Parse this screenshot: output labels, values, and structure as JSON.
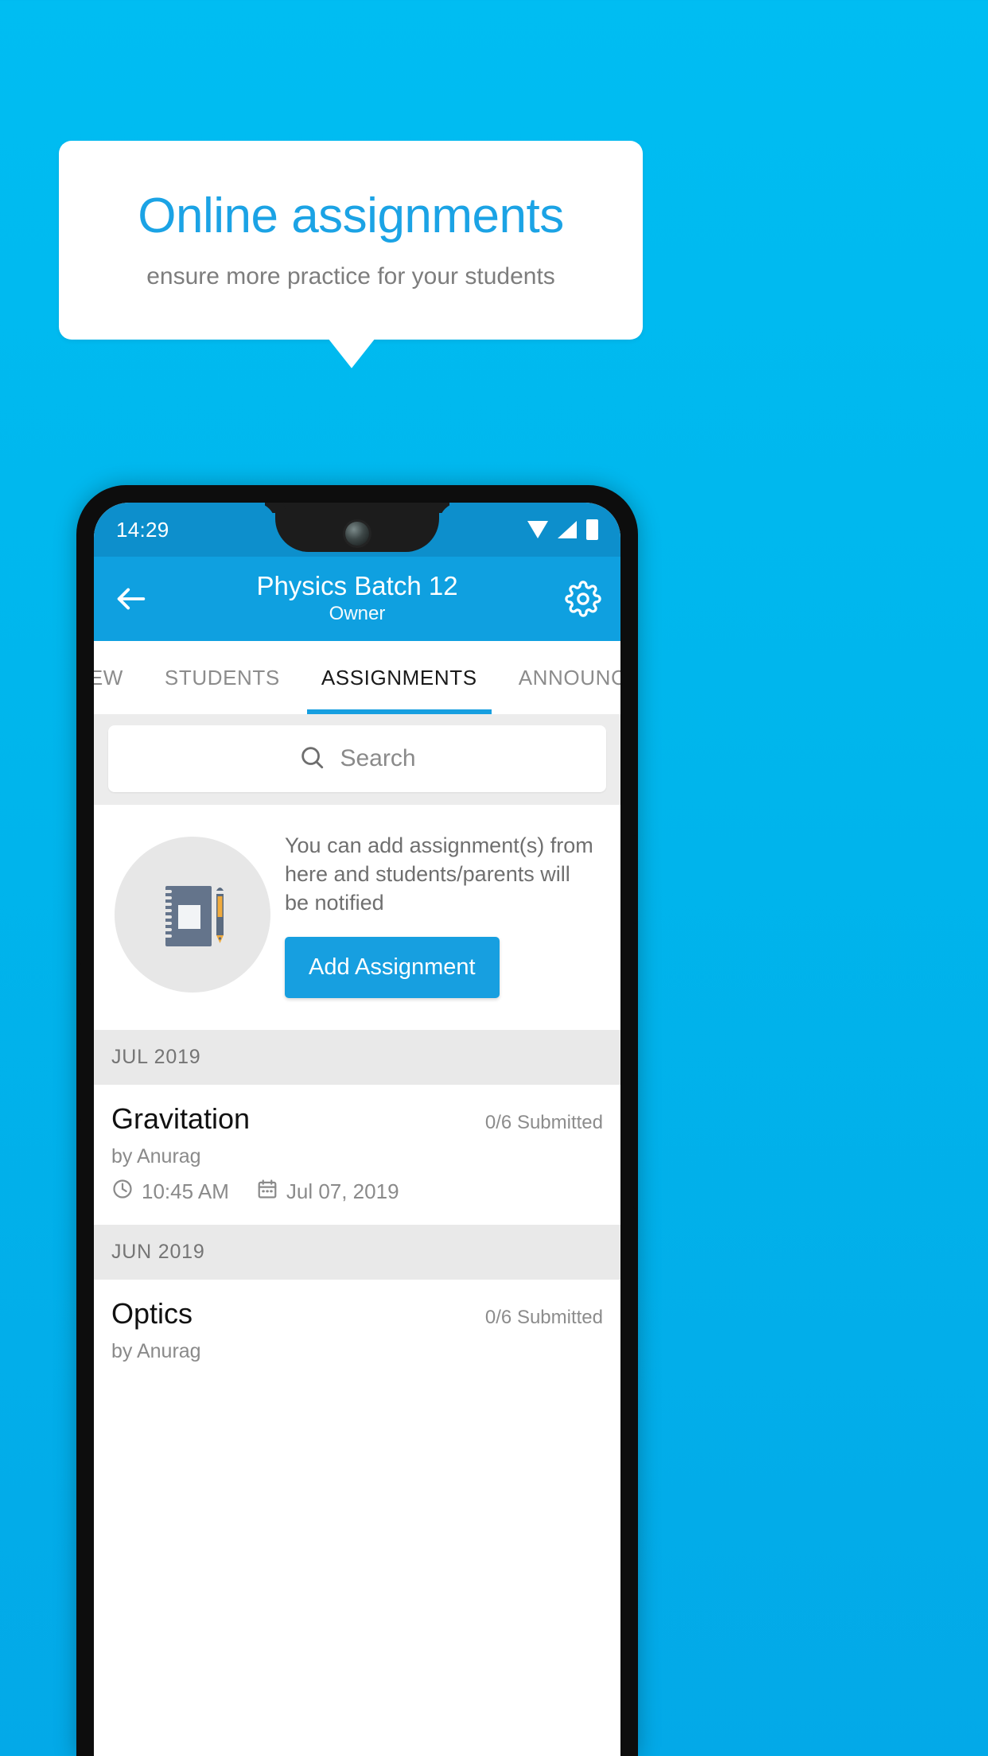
{
  "promo": {
    "title": "Online assignments",
    "subtitle": "ensure more practice for your students",
    "accent_color": "#1ba3e5",
    "background_color": "#00b5ec"
  },
  "phone": {
    "status_bar": {
      "time": "14:29",
      "icons": [
        "wifi-icon",
        "signal-icon",
        "battery-icon"
      ]
    },
    "app_bar": {
      "back_icon": "back-arrow-icon",
      "title": "Physics Batch 12",
      "subtitle": "Owner",
      "settings_icon": "gear-icon",
      "color": "#0fa0e0"
    },
    "tabs": [
      {
        "label": "IEW",
        "active": false
      },
      {
        "label": "STUDENTS",
        "active": false
      },
      {
        "label": "ASSIGNMENTS",
        "active": true
      },
      {
        "label": "ANNOUNCEM",
        "active": false
      }
    ],
    "search": {
      "placeholder": "Search",
      "icon": "search-icon"
    },
    "empty_state": {
      "illustration": "notebook-and-pen-icon",
      "message": "You can add assignment(s) from here and students/parents will be notified",
      "button_label": "Add Assignment",
      "button_color": "#179fe0"
    },
    "assignment_groups": [
      {
        "month": "JUL 2019",
        "items": [
          {
            "title": "Gravitation",
            "submitted": "0/6 Submitted",
            "author": "by Anurag",
            "time": "10:45 AM",
            "date": "Jul 07, 2019",
            "time_icon": "clock-icon",
            "date_icon": "calendar-icon"
          }
        ]
      },
      {
        "month": "JUN 2019",
        "items": [
          {
            "title": "Optics",
            "submitted": "0/6 Submitted",
            "author": "by Anurag",
            "time": "",
            "date": "",
            "time_icon": "clock-icon",
            "date_icon": "calendar-icon"
          }
        ]
      }
    ]
  }
}
